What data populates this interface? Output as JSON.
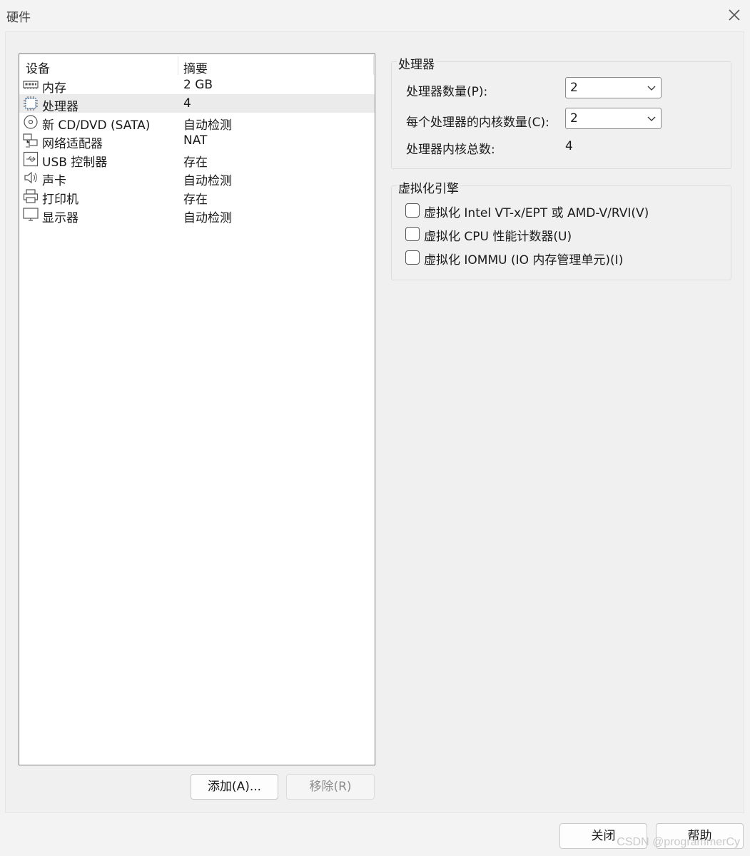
{
  "window": {
    "title": "硬件"
  },
  "device_list": {
    "columns": [
      "设备",
      "摘要"
    ],
    "rows": [
      {
        "icon": "memory-icon",
        "name": "内存",
        "summary": "2 GB"
      },
      {
        "icon": "processor-icon",
        "name": "处理器",
        "summary": "4",
        "selected": true
      },
      {
        "icon": "cd-dvd-icon",
        "name": "新 CD/DVD (SATA)",
        "summary": "自动检测"
      },
      {
        "icon": "network-adapter-icon",
        "name": "网络适配器",
        "summary": "NAT"
      },
      {
        "icon": "usb-icon",
        "name": "USB 控制器",
        "summary": "存在"
      },
      {
        "icon": "speaker-icon",
        "name": "声卡",
        "summary": "自动检测"
      },
      {
        "icon": "printer-icon",
        "name": "打印机",
        "summary": "存在"
      },
      {
        "icon": "monitor-icon",
        "name": "显示器",
        "summary": "自动检测"
      }
    ]
  },
  "list_buttons": {
    "add": "添加(A)...",
    "remove": "移除(R)"
  },
  "processor_group": {
    "title": "处理器",
    "count_label": "处理器数量(P):",
    "count_value": "2",
    "cores_label": "每个处理器的内核数量(C):",
    "cores_value": "2",
    "total_label": "处理器内核总数:",
    "total_value": "4"
  },
  "virt_group": {
    "title": "虚拟化引擎",
    "options": [
      {
        "label": "虚拟化 Intel VT-x/EPT 或 AMD-V/RVI(V)",
        "checked": false
      },
      {
        "label": "虚拟化 CPU 性能计数器(U)",
        "checked": false
      },
      {
        "label": "虚拟化 IOMMU (IO 内存管理单元)(I)",
        "checked": false
      }
    ]
  },
  "footer_buttons": {
    "close": "关闭",
    "help": "帮助"
  },
  "watermark": "CSDN @programmerCy"
}
